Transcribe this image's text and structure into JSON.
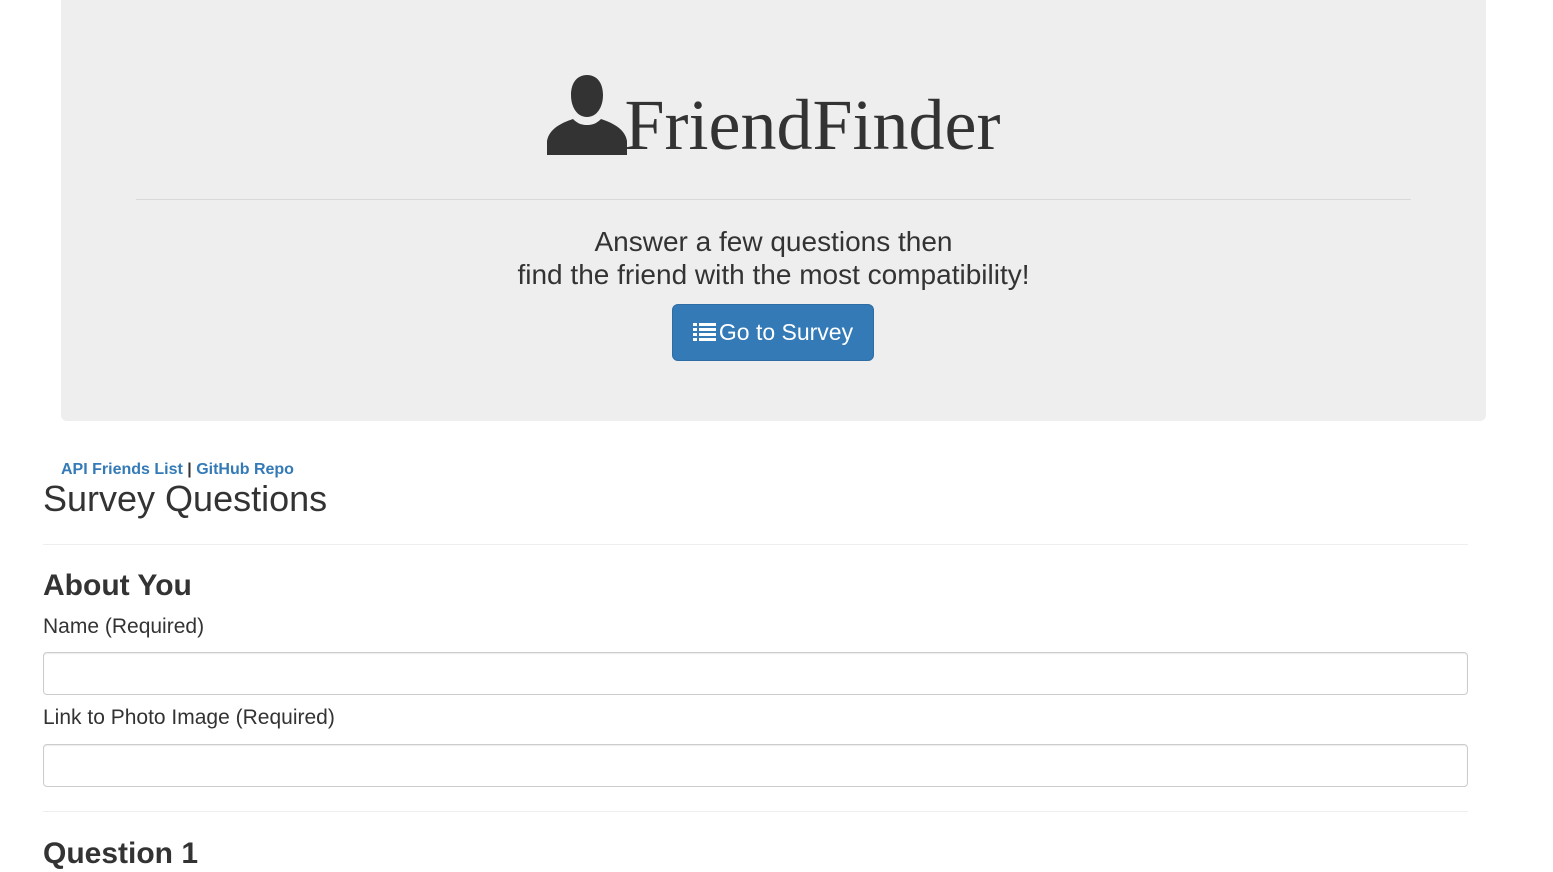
{
  "header": {
    "brand_icon": "user-icon",
    "brand_title": "FriendFinder",
    "tagline_line1": "Answer a few questions then",
    "tagline_line2": "find the friend with the most compatibility!",
    "survey_button": {
      "icon": "list-icon",
      "label": "Go to Survey",
      "color": "#337ab7"
    }
  },
  "links": {
    "api_friends": "API Friends List",
    "separator": "|",
    "github_repo": "GitHub Repo",
    "color": "#337ab7"
  },
  "survey": {
    "title": "Survey Questions",
    "about_section": {
      "title": "About You",
      "name_label": "Name (Required)",
      "name_value": "",
      "photo_label": "Link to Photo Image (Required)",
      "photo_value": ""
    },
    "question1_title": "Question 1"
  }
}
